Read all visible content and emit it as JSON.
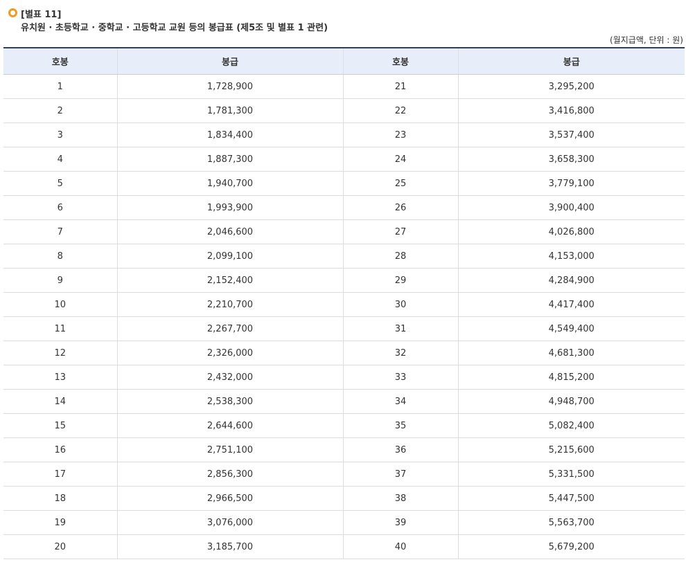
{
  "doc": {
    "label": "[별표 11]",
    "title": "유치원 · 초등학교 · 중학교 · 고등학교 교원 등의 봉급표 (제5조 및 별표 1 관련)",
    "unit_note": "(월지급액, 단위 : 원)"
  },
  "table": {
    "headers": [
      "호봉",
      "봉급",
      "호봉",
      "봉급"
    ],
    "rows": [
      [
        "1",
        "1,728,900",
        "21",
        "3,295,200"
      ],
      [
        "2",
        "1,781,300",
        "22",
        "3,416,800"
      ],
      [
        "3",
        "1,834,400",
        "23",
        "3,537,400"
      ],
      [
        "4",
        "1,887,300",
        "24",
        "3,658,300"
      ],
      [
        "5",
        "1,940,700",
        "25",
        "3,779,100"
      ],
      [
        "6",
        "1,993,900",
        "26",
        "3,900,400"
      ],
      [
        "7",
        "2,046,600",
        "27",
        "4,026,800"
      ],
      [
        "8",
        "2,099,100",
        "28",
        "4,153,000"
      ],
      [
        "9",
        "2,152,400",
        "29",
        "4,284,900"
      ],
      [
        "10",
        "2,210,700",
        "30",
        "4,417,400"
      ],
      [
        "11",
        "2,267,700",
        "31",
        "4,549,400"
      ],
      [
        "12",
        "2,326,000",
        "32",
        "4,681,300"
      ],
      [
        "13",
        "2,432,000",
        "33",
        "4,815,200"
      ],
      [
        "14",
        "2,538,300",
        "34",
        "4,948,700"
      ],
      [
        "15",
        "2,644,600",
        "35",
        "5,082,400"
      ],
      [
        "16",
        "2,751,100",
        "36",
        "5,215,600"
      ],
      [
        "17",
        "2,856,300",
        "37",
        "5,331,500"
      ],
      [
        "18",
        "2,966,500",
        "38",
        "5,447,500"
      ],
      [
        "19",
        "3,076,000",
        "39",
        "5,563,700"
      ],
      [
        "20",
        "3,185,700",
        "40",
        "5,679,200"
      ]
    ]
  },
  "colors": {
    "accent": "#f29a1d",
    "header_bg": "#e8eef9",
    "header_rule": "#333e55"
  }
}
